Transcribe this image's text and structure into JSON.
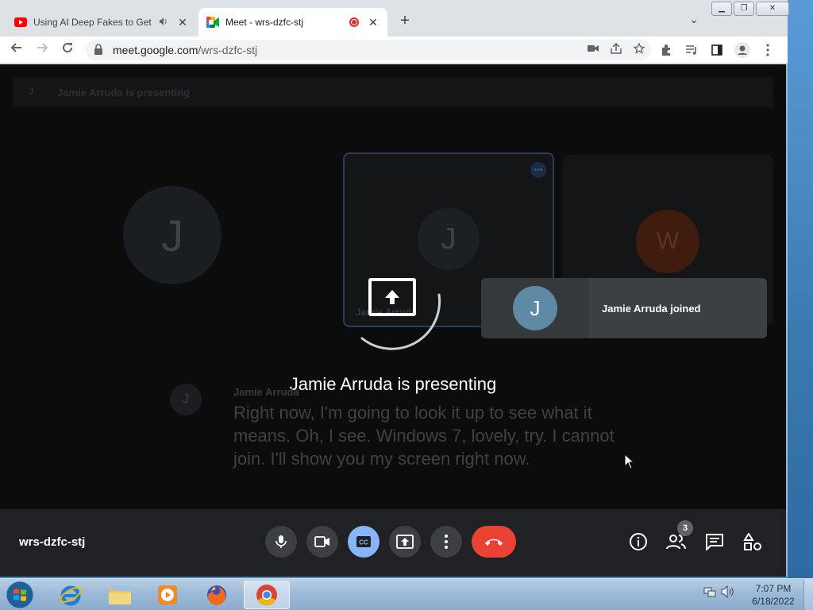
{
  "browser": {
    "tabs": [
      {
        "title": "Using AI Deep Fakes to Get F",
        "favicon": "youtube-icon",
        "audio": true
      },
      {
        "title": "Meet - wrs-dzfc-stj",
        "favicon": "google-meet-icon",
        "recording": true
      }
    ],
    "address": {
      "domain": "meet.google.com",
      "path": "/wrs-dzfc-stj"
    },
    "window_controls": [
      "minimize",
      "restore",
      "close"
    ]
  },
  "meet": {
    "banner_avatar": "J",
    "banner_text": "Jamie Arruda is presenting",
    "tiles": [
      {
        "initial": "J",
        "name": ""
      },
      {
        "initial": "J",
        "name": "Jamie Arruda"
      },
      {
        "initial": "W",
        "name": ""
      }
    ],
    "presenting_title": "Jamie Arruda is presenting",
    "caption": {
      "avatar": "J",
      "speaker": "Jamie Arruda",
      "text": "Right now, I'm going to look it up to see what it means. Oh, I see. Windows 7, lovely, try. I cannot join. I'll show you my screen right now."
    },
    "toast": {
      "avatar": "J",
      "text": "Jamie Arruda joined"
    },
    "meeting_code": "wrs-dzfc-stj",
    "people_count": "3",
    "colors": {
      "end_call": "#ea4335",
      "cc_active": "#8ab4f8",
      "avatar_w": "#c1440e",
      "toast_avatar": "#5f8aa6"
    }
  },
  "taskbar": {
    "time": "7:07 PM",
    "date": "6/18/2022",
    "apps": [
      "windows-start-icon",
      "internet-explorer-icon",
      "file-explorer-icon",
      "media-player-icon",
      "firefox-icon",
      "chrome-icon"
    ]
  }
}
